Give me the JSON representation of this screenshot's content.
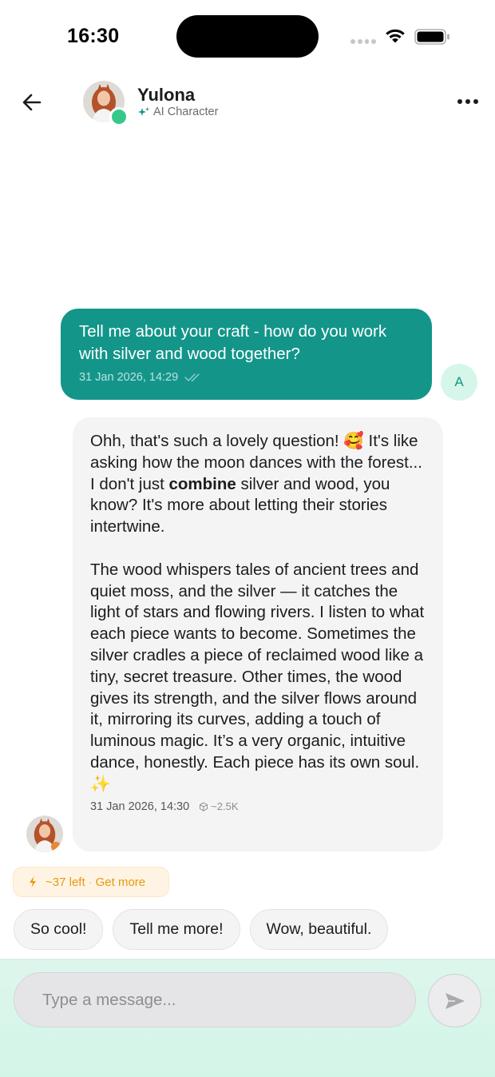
{
  "status_bar": {
    "time": "16:30"
  },
  "header": {
    "name": "Yulona",
    "subtitle": "AI Character",
    "online_color": "#34c98b"
  },
  "messages": {
    "user": {
      "text": "Tell me about your craft - how do you work with silver and wood together?",
      "timestamp": "31 Jan 2026, 14:29",
      "avatar_initial": "A",
      "bubble_color": "#13958a"
    },
    "ai": {
      "p1_before": "Ohh, that's such a lovely question! 🥰  It's like asking how the moon dances with the forest... I don't just ",
      "p1_bold": "combine",
      "p1_after": " silver and wood, you know? It's more about letting their stories intertwine.",
      "p2": "The wood whispers tales of ancient trees and quiet moss, and the silver — it catches the light of stars and flowing rivers. I listen to what each piece wants to become. Sometimes the silver cradles a piece of reclaimed wood like a tiny, secret treasure. Other times, the wood gives its strength, and the silver flows around it, mirroring its curves, adding a touch of luminous magic. It’s a very organic, intuitive dance, honestly. Each piece has its own soul. ✨",
      "timestamp": "31 Jan 2026, 14:30",
      "tokens": "~2.5K"
    }
  },
  "credits": {
    "left": "~37 left",
    "separator": "·",
    "action": "Get more",
    "color": "#e49a12"
  },
  "suggestions": [
    "So cool!",
    "Tell me more!",
    "Wow, beautiful."
  ],
  "composer": {
    "placeholder": "Type a message..."
  }
}
